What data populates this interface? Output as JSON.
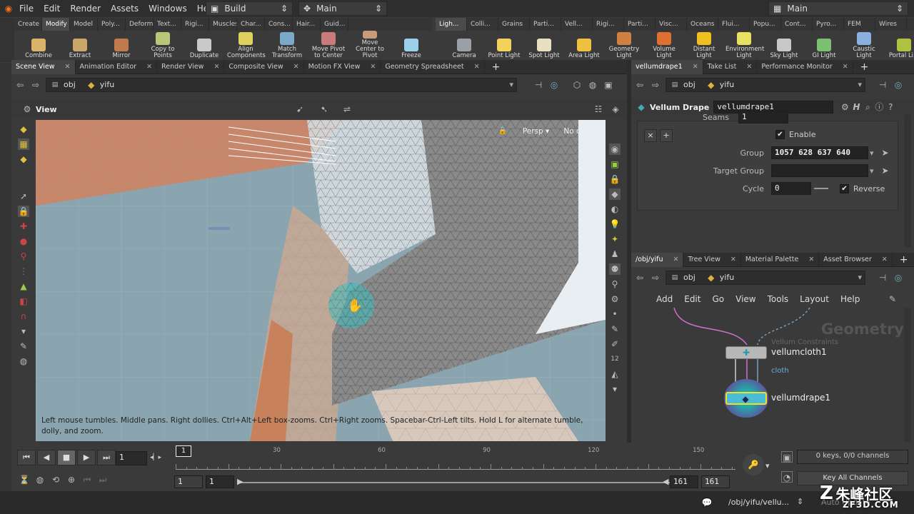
{
  "menubar": {
    "items": [
      "File",
      "Edit",
      "Render",
      "Assets",
      "Windows",
      "Help"
    ],
    "desktop": "Build",
    "desktop_right": "Main",
    "runmode": "Main"
  },
  "shelf_left": {
    "tabs": [
      "Create",
      "Modify",
      "Model",
      "Poly...",
      "Deform",
      "Text...",
      "Rigi...",
      "Muscles",
      "Char...",
      "Cons...",
      "Hair...",
      "Guid..."
    ],
    "active_tab": "Modify",
    "tools": [
      {
        "label": "Combine",
        "color": "#d9b36a"
      },
      {
        "label": "Extract",
        "color": "#c9a86a"
      },
      {
        "label": "Mirror",
        "color": "#c07a4e"
      },
      {
        "label": "Copy to Points",
        "color": "#b9c67a"
      },
      {
        "label": "Duplicate",
        "color": "#c9c9c9"
      },
      {
        "label": "Align Components",
        "color": "#e0d060"
      },
      {
        "label": "Match Transform",
        "color": "#7aa9c9"
      },
      {
        "label": "Move Pivot to Center",
        "color": "#c97a7a"
      },
      {
        "label": "Move Center to Pivot",
        "color": "#c99a7a"
      },
      {
        "label": "Freeze",
        "color": "#9ad1e8"
      }
    ]
  },
  "shelf_right": {
    "tabs": [
      "Ligh...",
      "Colli...",
      "Grains",
      "Parti...",
      "Vell...",
      "Rigi...",
      "Parti...",
      "Visc...",
      "Oceans",
      "Flui...",
      "Popu...",
      "Cont...",
      "Pyro...",
      "FEM",
      "Wires"
    ],
    "active_tab": "Ligh...",
    "tools": [
      {
        "label": "Camera",
        "color": "#9aa0a8"
      },
      {
        "label": "Point Light",
        "color": "#f2d25a"
      },
      {
        "label": "Spot Light",
        "color": "#e8e0c0"
      },
      {
        "label": "Area Light",
        "color": "#f0c040"
      },
      {
        "label": "Geometry Light",
        "color": "#d08040"
      },
      {
        "label": "Volume Light",
        "color": "#e07030"
      },
      {
        "label": "Distant Light",
        "color": "#f0c020"
      },
      {
        "label": "Environment Light",
        "color": "#e8e060"
      },
      {
        "label": "Sky Light",
        "color": "#c8c8c8"
      },
      {
        "label": "GI Light",
        "color": "#7ac070"
      },
      {
        "label": "Caustic Light",
        "color": "#8ab0e0"
      },
      {
        "label": "Portal Li...",
        "color": "#b0c040"
      }
    ]
  },
  "scene_tabs": [
    {
      "label": "Scene View",
      "active": true
    },
    {
      "label": "Animation Editor"
    },
    {
      "label": "Render View"
    },
    {
      "label": "Composite View"
    },
    {
      "label": "Motion FX View"
    },
    {
      "label": "Geometry Spreadsheet"
    }
  ],
  "scene_path": {
    "root": "obj",
    "node": "yifu"
  },
  "viewport": {
    "title": "View",
    "camera": "Persp ▾",
    "cam": "No cam ▾",
    "hint": "Left mouse tumbles. Middle pans. Right dollies. Ctrl+Alt+Left box-zooms. Ctrl+Right zooms. Spacebar-Ctrl-Left tilts. Hold L for alternate tumble, dolly, and zoom."
  },
  "param_tabs": [
    {
      "label": "vellumdrape1",
      "active": true
    },
    {
      "label": "Take List"
    },
    {
      "label": "Performance Monitor"
    }
  ],
  "param_path": {
    "root": "obj",
    "node": "yifu"
  },
  "params": {
    "node_type": "Vellum Drape",
    "node_name": "vellumdrape1",
    "seams_label": "Seams",
    "seams_value": "1",
    "enable_label": "Enable",
    "group_label": "Group",
    "group_value": "1057 628 637 640",
    "target_group_label": "Target Group",
    "target_group_value": "",
    "cycle_label": "Cycle",
    "cycle_value": "0",
    "reverse_label": "Reverse"
  },
  "network_tabs": [
    {
      "label": "/obj/yifu",
      "active": true
    },
    {
      "label": "Tree View"
    },
    {
      "label": "Material Palette"
    },
    {
      "label": "Asset Browser"
    }
  ],
  "network_path": {
    "root": "obj",
    "node": "yifu"
  },
  "network_menu": [
    "Add",
    "Edit",
    "Go",
    "View",
    "Tools",
    "Layout",
    "Help"
  ],
  "network": {
    "context": "Geometry",
    "node1_type": "Vellum Constraints",
    "node1_name": "vellumcloth1",
    "node1_out": "cloth",
    "node2_name": "vellumdrape1"
  },
  "timeline": {
    "current_frame": "1",
    "ticks": [
      "30",
      "60",
      "90",
      "120",
      "150"
    ],
    "playhead": "1",
    "range_start": "1",
    "range_start2": "1",
    "range_end": "161",
    "range_end2": "161",
    "keys_label": "0 keys, 0/0 channels",
    "key_all": "Key All Channels"
  },
  "statusbar": {
    "path": "/obj/yifu/vellu...",
    "watermark": "朱峰社区",
    "watermark_url": "ZF3D.COM",
    "auto_update": "Auto Update"
  }
}
